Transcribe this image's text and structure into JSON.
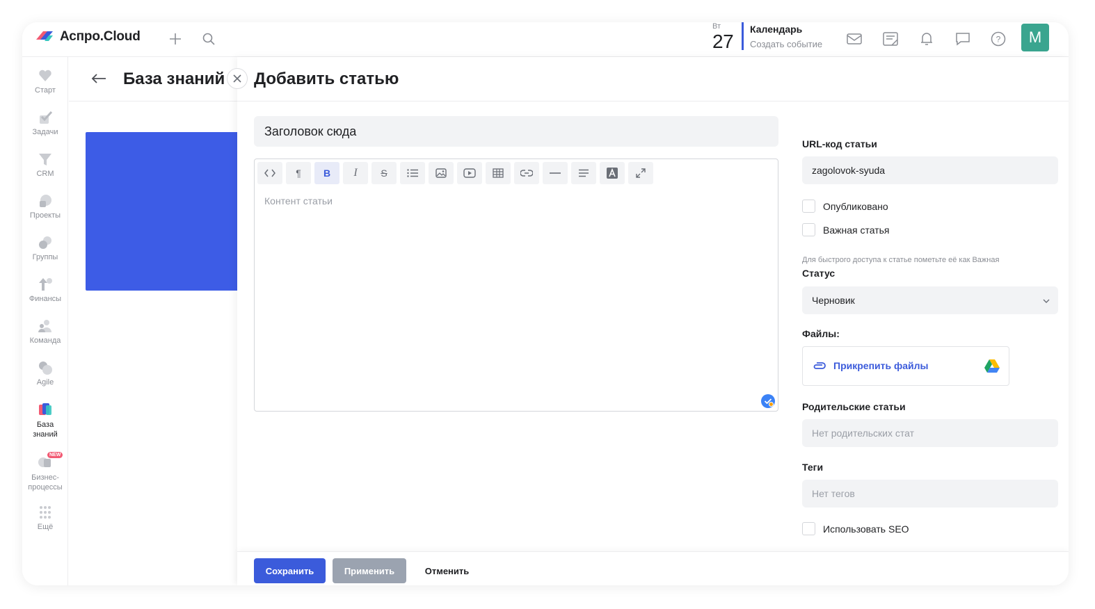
{
  "header": {
    "app_title": "Аспро.Cloud",
    "add_icon": "plus-icon",
    "search_icon": "search-icon",
    "date_dow": "Вт",
    "date_day": "27",
    "calendar_title": "Календарь",
    "calendar_sub": "Создать событие",
    "icons": [
      "mail-icon",
      "notes-icon",
      "bell-icon",
      "chat-icon",
      "help-icon"
    ],
    "avatar_letter": "M",
    "avatar_color": "#3aa58f"
  },
  "sidebar": {
    "items": [
      {
        "label": "Старт",
        "icon": "heart-icon"
      },
      {
        "label": "Задачи",
        "icon": "check-icon"
      },
      {
        "label": "CRM",
        "icon": "funnel-icon"
      },
      {
        "label": "Проекты",
        "icon": "projects-icon"
      },
      {
        "label": "Группы",
        "icon": "groups-icon"
      },
      {
        "label": "Финансы",
        "icon": "finance-icon"
      },
      {
        "label": "Команда",
        "icon": "team-icon"
      },
      {
        "label": "Agile",
        "icon": "agile-icon"
      },
      {
        "label": "База знаний",
        "icon": "knowledge-base-icon"
      },
      {
        "label": "Бизнес-процессы",
        "icon": "business-process-icon",
        "badge": "NEW"
      },
      {
        "label": "Ещё",
        "icon": "more-grid-icon"
      }
    ]
  },
  "background_page": {
    "title": "База знаний",
    "card_color": "#3d5ce6"
  },
  "drawer": {
    "title": "Добавить статью",
    "title_input_value": "Заголовок сюда",
    "toolbar": [
      "code-icon",
      "paragraph-icon",
      "bold-icon",
      "italic-icon",
      "strikethrough-icon",
      "list-icon",
      "image-icon",
      "video-icon",
      "table-icon",
      "link-icon",
      "horizontal-rule-icon",
      "align-icon",
      "font-color-icon",
      "fullscreen-icon"
    ],
    "toolbar_glyphs": {
      "paragraph": "¶",
      "bold": "B",
      "italic": "I",
      "strike": "S"
    },
    "editor_placeholder": "Контент статьи",
    "url_label": "URL-код статьи",
    "url_value": "zagolovok-syuda",
    "published_label": "Опубликовано",
    "important_label": "Важная статья",
    "important_hint": "Для быстрого доступа к статье пометьте её как Важная",
    "status_label": "Статус",
    "status_value": "Черновик",
    "files_label": "Файлы:",
    "attach_label": "Прикрепить файлы",
    "parent_label": "Родительские статьи",
    "parent_placeholder": "Нет родительских стат",
    "tags_label": "Теги",
    "tags_placeholder": "Нет тегов",
    "seo_label": "Использовать SEO"
  },
  "footer": {
    "save": "Сохранить",
    "apply": "Применить",
    "cancel": "Отменить"
  },
  "colors": {
    "accent": "#3b5bdb",
    "disabled_button": "#9ba3b0"
  }
}
